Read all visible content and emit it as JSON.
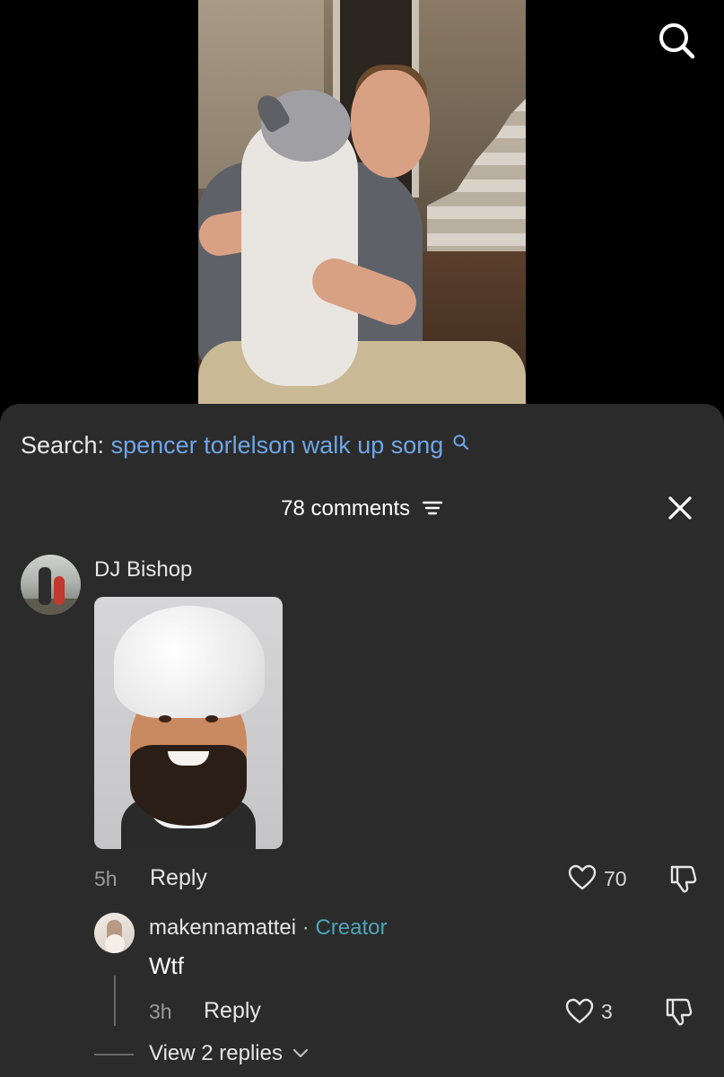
{
  "search": {
    "prefix": "Search:",
    "query": "spencer torlelson walk up song"
  },
  "comments_panel": {
    "count_label": "78 comments"
  },
  "comment": {
    "username": "DJ Bishop",
    "time": "5h",
    "reply_label": "Reply",
    "likes": "70"
  },
  "reply": {
    "username": "makennamattei",
    "separator": "·",
    "badge": "Creator",
    "text": "Wtf",
    "time": "3h",
    "reply_label": "Reply",
    "likes": "3"
  },
  "view_replies_label": "View 2 replies",
  "icons": {
    "top_search": "search-icon",
    "filter": "filter-icon",
    "close": "close-icon",
    "like": "heart-icon",
    "dislike": "thumbs-down-icon",
    "expand": "chevron-down-icon"
  },
  "colors": {
    "sheet_background": "#2b2b2b",
    "search_link": "#6fa6e8",
    "creator_badge": "#4fa3b8"
  }
}
